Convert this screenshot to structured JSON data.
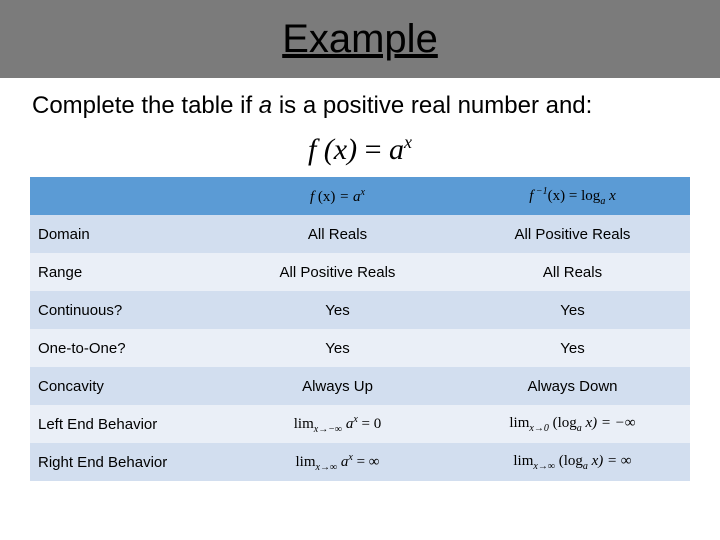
{
  "title": "Example",
  "prompt_pre": "Complete the table if ",
  "prompt_var": "a",
  "prompt_post": " is a positive real number and:",
  "main_formula": {
    "lhs": "f (x)",
    "eq": " = ",
    "base": "a",
    "exp": "x"
  },
  "header": {
    "col1": {
      "f": "f ",
      "arg": "(x)",
      "eq": " = a",
      "exp": "x"
    },
    "col2": {
      "finv_f": "f",
      "finv_exp": " −1",
      "arg": "(x)",
      "eq": " = log",
      "sub": "a",
      "after": " x"
    }
  },
  "rows": [
    {
      "label": "Domain",
      "c1": "All Reals",
      "c2": "All Positive Reals"
    },
    {
      "label": "Range",
      "c1": "All Positive Reals",
      "c2": "All Reals"
    },
    {
      "label": "Continuous?",
      "c1": "Yes",
      "c2": "Yes"
    },
    {
      "label": "One-to-One?",
      "c1": "Yes",
      "c2": "Yes"
    },
    {
      "label": "Concavity",
      "c1": "Always Up",
      "c2": "Always Down"
    }
  ],
  "row_left_label": "Left End Behavior",
  "row_right_label": "Right End Behavior",
  "lim_left": {
    "c1": {
      "pre": "lim",
      "sub": "x→−∞",
      "body": " a",
      "exp": "x",
      "eq": " = 0"
    },
    "c2": {
      "pre": "lim",
      "sub": "x→0",
      "body": " (log",
      "logsub": "a",
      "after": " x) = −∞"
    }
  },
  "lim_right": {
    "c1": {
      "pre": "lim",
      "sub": "x→∞",
      "body": " a",
      "exp": "x",
      "eq": " = ∞"
    },
    "c2": {
      "pre": "lim",
      "sub": "x→∞",
      "body": " (log",
      "logsub": "a",
      "after": " x) = ∞"
    }
  }
}
